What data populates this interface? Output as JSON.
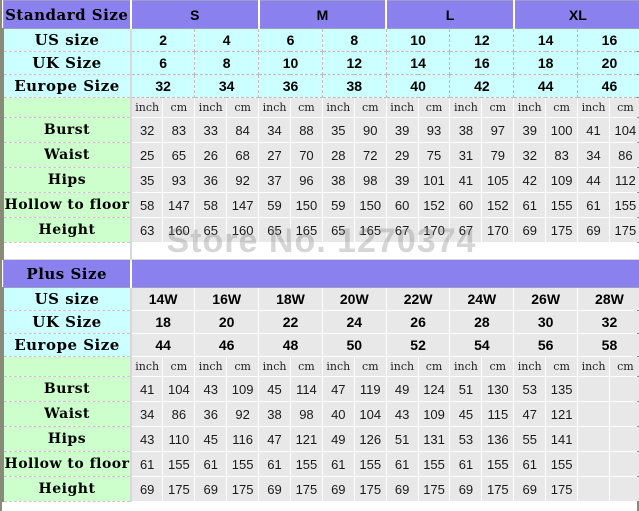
{
  "watermark": "Store No. 1270374",
  "colors": {
    "header_purple": "#8A80EE",
    "size_label_cyan": "#CCFFFF",
    "measure_label_green": "#CCFFCC",
    "data_cell_grey": "#E8E8E8",
    "page_background": "#FFFFFF"
  },
  "standard_table": {
    "title": "Standard Size",
    "size_groups": [
      {
        "label": "S",
        "span": 2
      },
      {
        "label": "M",
        "span": 2
      },
      {
        "label": "L",
        "span": 2
      },
      {
        "label": "XL",
        "span": 2
      }
    ],
    "size_rows": [
      {
        "label": "US size",
        "values": [
          "2",
          "4",
          "6",
          "8",
          "10",
          "12",
          "14",
          "16"
        ]
      },
      {
        "label": "UK Size",
        "values": [
          "6",
          "8",
          "10",
          "12",
          "14",
          "16",
          "18",
          "20"
        ]
      },
      {
        "label": "Europe Size",
        "values": [
          "32",
          "34",
          "36",
          "38",
          "40",
          "42",
          "44",
          "46"
        ]
      }
    ],
    "unit_row": {
      "label": "",
      "units": [
        "inch",
        "cm",
        "inch",
        "cm",
        "inch",
        "cm",
        "inch",
        "cm",
        "inch",
        "cm",
        "inch",
        "cm",
        "inch",
        "cm",
        "inch",
        "cm"
      ]
    },
    "measure_rows": [
      {
        "label": "Burst",
        "values": [
          "32",
          "83",
          "33",
          "84",
          "34",
          "88",
          "35",
          "90",
          "39",
          "93",
          "38",
          "97",
          "39",
          "100",
          "41",
          "104"
        ]
      },
      {
        "label": "Waist",
        "values": [
          "25",
          "65",
          "26",
          "68",
          "27",
          "70",
          "28",
          "72",
          "29",
          "75",
          "31",
          "79",
          "32",
          "83",
          "34",
          "86"
        ]
      },
      {
        "label": "Hips",
        "values": [
          "35",
          "93",
          "36",
          "92",
          "37",
          "96",
          "38",
          "98",
          "39",
          "101",
          "41",
          "105",
          "42",
          "109",
          "44",
          "112"
        ]
      },
      {
        "label": "Hollow to floor",
        "values": [
          "58",
          "147",
          "58",
          "147",
          "59",
          "150",
          "59",
          "150",
          "60",
          "152",
          "60",
          "152",
          "61",
          "155",
          "61",
          "155"
        ]
      },
      {
        "label": "Height",
        "values": [
          "63",
          "160",
          "65",
          "160",
          "65",
          "165",
          "65",
          "165",
          "67",
          "170",
          "67",
          "170",
          "69",
          "175",
          "69",
          "175"
        ]
      }
    ]
  },
  "plus_table": {
    "title": "Plus Size",
    "size_rows": [
      {
        "label": "US size",
        "values": [
          "14W",
          "16W",
          "18W",
          "20W",
          "22W",
          "24W",
          "26W",
          "28W"
        ]
      },
      {
        "label": "UK Size",
        "values": [
          "18",
          "20",
          "22",
          "24",
          "26",
          "28",
          "30",
          "32"
        ]
      },
      {
        "label": "Europe Size",
        "values": [
          "44",
          "46",
          "48",
          "50",
          "52",
          "54",
          "56",
          "58"
        ]
      }
    ],
    "unit_row": {
      "label": "",
      "units": [
        "inch",
        "cm",
        "inch",
        "cm",
        "inch",
        "cm",
        "inch",
        "cm",
        "inch",
        "cm",
        "inch",
        "cm",
        "inch",
        "cm",
        "inch",
        "cm"
      ]
    },
    "measure_rows": [
      {
        "label": "Burst",
        "values": [
          "41",
          "104",
          "43",
          "109",
          "45",
          "114",
          "47",
          "119",
          "49",
          "124",
          "51",
          "130",
          "53",
          "135",
          "",
          ""
        ]
      },
      {
        "label": "Waist",
        "values": [
          "34",
          "86",
          "36",
          "92",
          "38",
          "98",
          "40",
          "104",
          "43",
          "109",
          "45",
          "115",
          "47",
          "121",
          "",
          ""
        ]
      },
      {
        "label": "Hips",
        "values": [
          "43",
          "110",
          "45",
          "116",
          "47",
          "121",
          "49",
          "126",
          "51",
          "131",
          "53",
          "136",
          "55",
          "141",
          "",
          ""
        ]
      },
      {
        "label": "Hollow to floor",
        "values": [
          "61",
          "155",
          "61",
          "155",
          "61",
          "155",
          "61",
          "155",
          "61",
          "155",
          "61",
          "155",
          "61",
          "155",
          "",
          ""
        ]
      },
      {
        "label": "Height",
        "values": [
          "69",
          "175",
          "69",
          "175",
          "69",
          "175",
          "69",
          "175",
          "69",
          "175",
          "69",
          "175",
          "69",
          "175",
          "",
          ""
        ]
      }
    ]
  }
}
